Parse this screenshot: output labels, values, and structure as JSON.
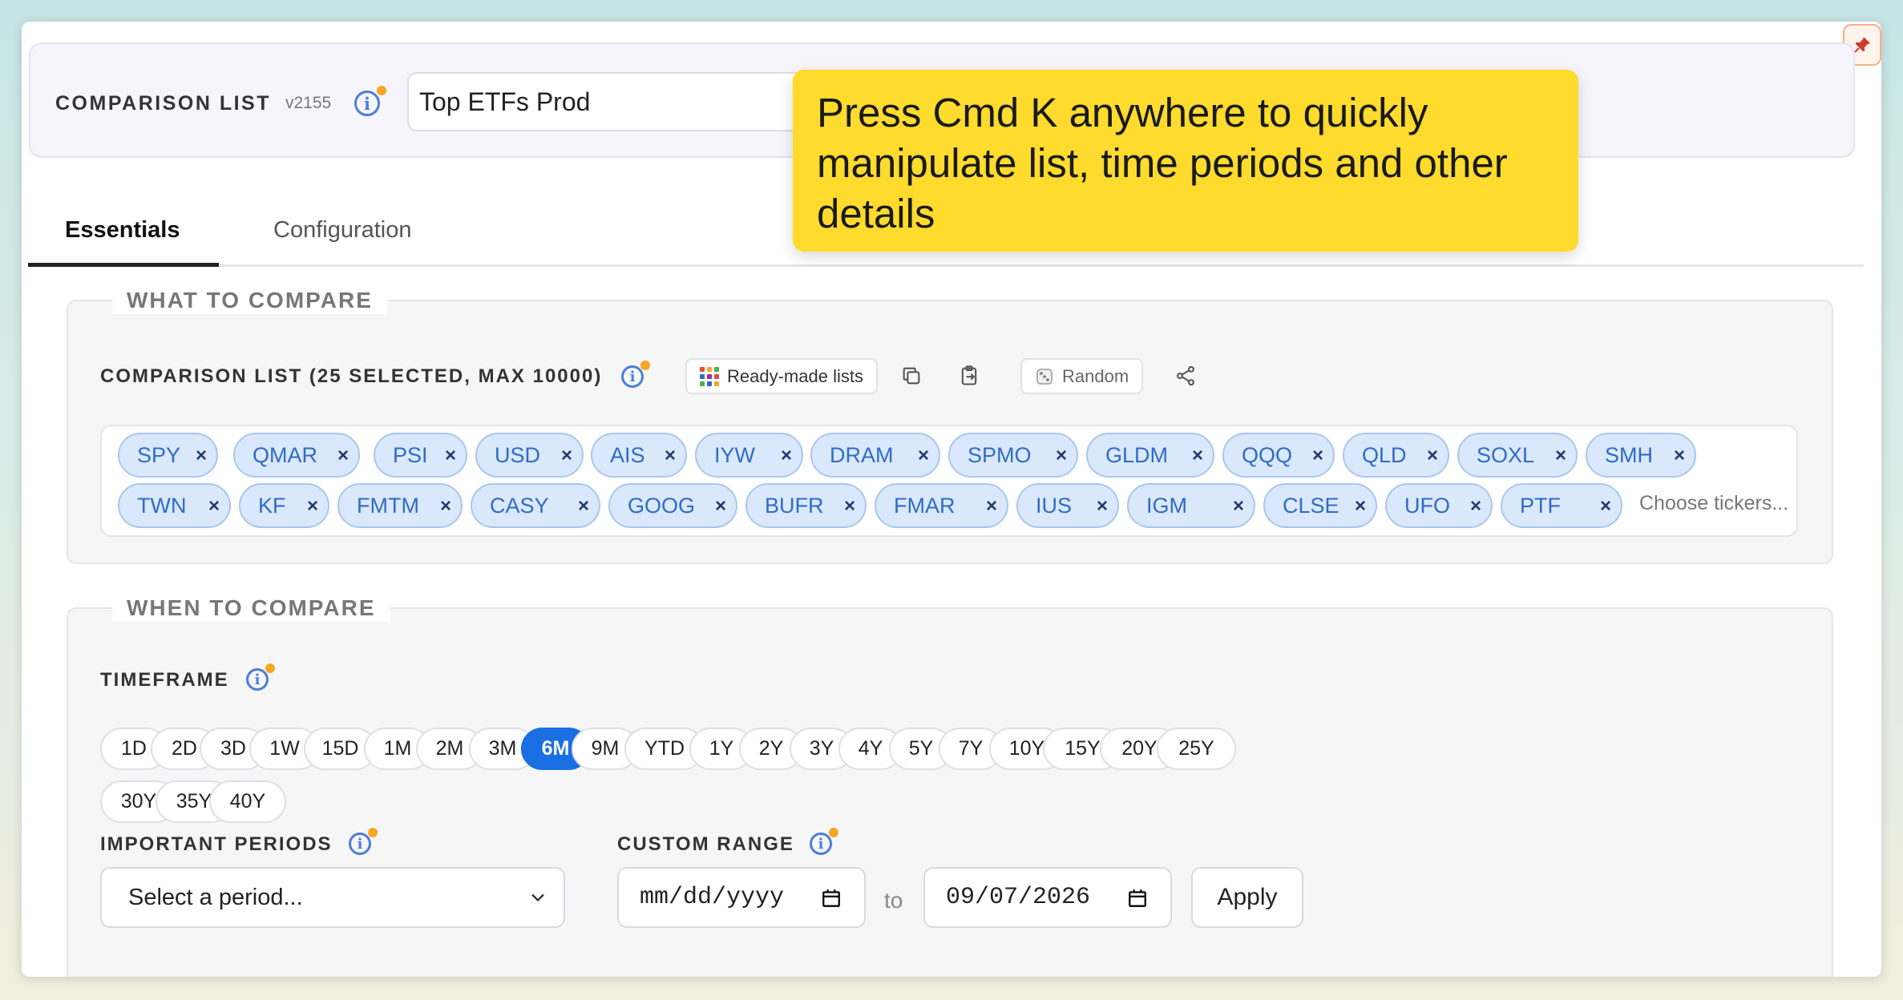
{
  "header": {
    "title": "COMPARISON LIST",
    "version": "v2155",
    "list_name": "Top ETFs Prod"
  },
  "tooltip": {
    "text": "Press Cmd K anywhere to quickly manipulate list, time periods and other details"
  },
  "tabs": [
    {
      "label": "Essentials",
      "active": true
    },
    {
      "label": "Configuration",
      "active": false
    }
  ],
  "what_to_compare": {
    "legend": "WHAT TO COMPARE",
    "list_label": "COMPARISON LIST (25 SELECTED, MAX 10000)",
    "ready_made_label": "Ready-made lists",
    "random_label": "Random",
    "tickers": [
      "SPY",
      "QMAR",
      "PSI",
      "USD",
      "AIS",
      "IYW",
      "DRAM",
      "SPMO",
      "GLDM",
      "QQQ",
      "QLD",
      "SOXL",
      "SMH",
      "TWN",
      "KF",
      "FMTM",
      "CASY",
      "GOOG",
      "BUFR",
      "FMAR",
      "IUS",
      "IGM",
      "CLSE",
      "UFO",
      "PTF"
    ],
    "ticker_placeholder": "Choose tickers...",
    "remove_glyph": "×"
  },
  "when_to_compare": {
    "legend": "WHEN TO COMPARE",
    "timeframe_label": "TIMEFRAME",
    "timeframes": [
      "1D",
      "2D",
      "3D",
      "1W",
      "15D",
      "1M",
      "2M",
      "3M",
      "6M",
      "9M",
      "YTD",
      "1Y",
      "2Y",
      "3Y",
      "4Y",
      "5Y",
      "7Y",
      "10Y",
      "15Y",
      "20Y",
      "25Y",
      "30Y",
      "35Y",
      "40Y"
    ],
    "active_timeframe": "6M",
    "important_periods_label": "IMPORTANT PERIODS",
    "period_select_value": "Select a period...",
    "custom_range_label": "CUSTOM RANGE",
    "start_date": "mm/dd/yyyy",
    "to_label": "to",
    "end_date": "09/07/2026",
    "apply_label": "Apply"
  },
  "colors": {
    "accent": "#1a6fe3",
    "chip_bg": "#dae8fb",
    "chip_text": "#2f6bc7",
    "tooltip_bg": "#fedb2d",
    "info_dot": "#f5a623"
  }
}
